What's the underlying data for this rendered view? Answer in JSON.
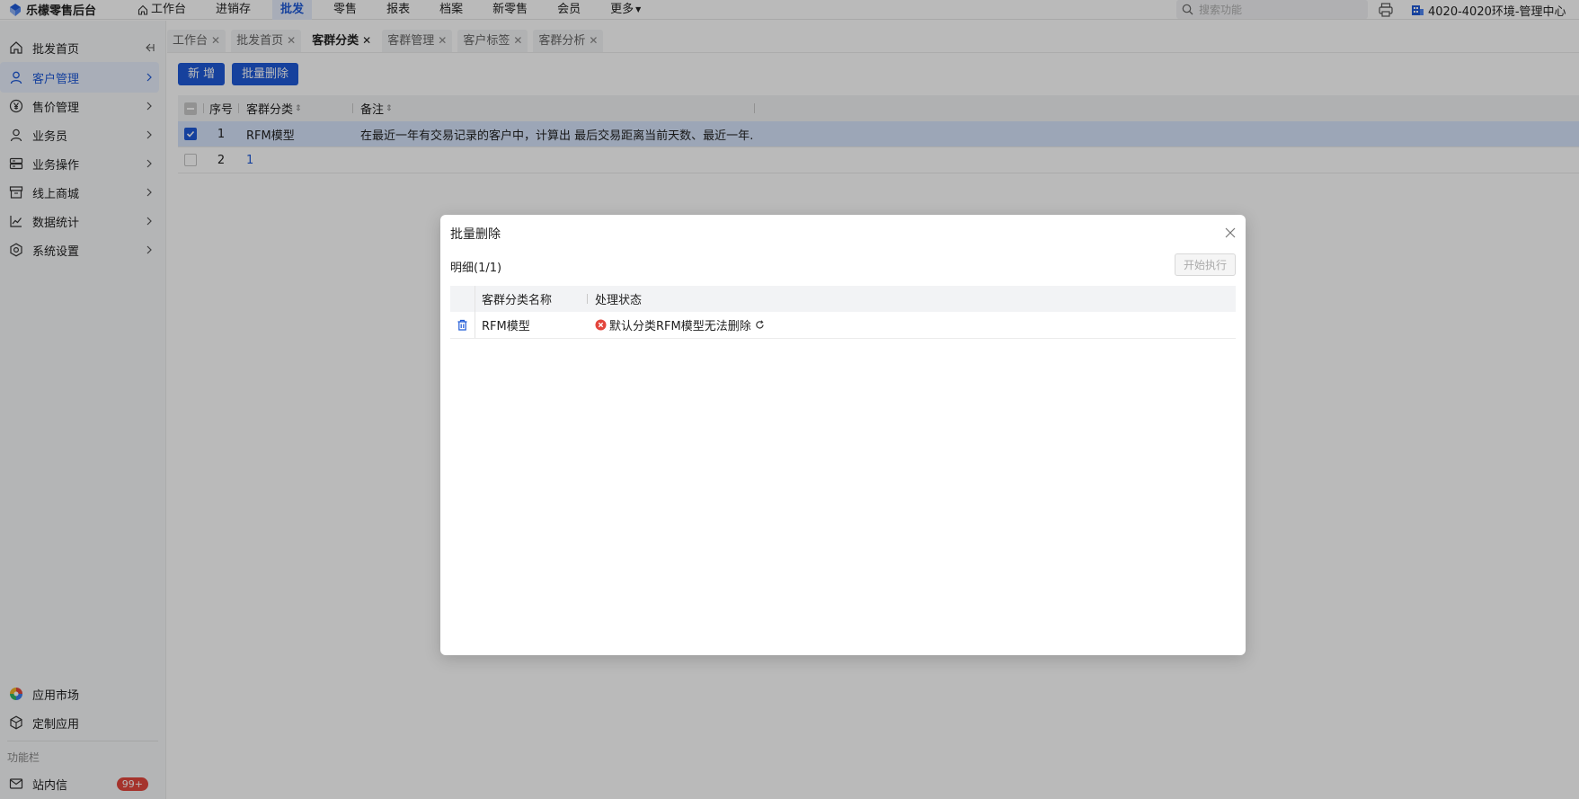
{
  "app": {
    "title": "乐檬零售后台"
  },
  "topnav": [
    {
      "label": "工作台",
      "icon": "home-icon",
      "active": false
    },
    {
      "label": "进销存",
      "active": false
    },
    {
      "label": "批发",
      "active": true
    },
    {
      "label": "零售",
      "active": false
    },
    {
      "label": "报表",
      "active": false
    },
    {
      "label": "档案",
      "active": false
    },
    {
      "label": "新零售",
      "active": false
    },
    {
      "label": "会员",
      "active": false
    },
    {
      "label": "更多",
      "active": false,
      "dropdown": true
    }
  ],
  "search": {
    "placeholder": "搜索功能"
  },
  "org": {
    "label": "4020-4020环境-管理中心"
  },
  "sidebar": {
    "items": [
      {
        "label": "批发首页",
        "icon": "home-icon",
        "collapse_icon": "collapse-left-icon"
      },
      {
        "label": "客户管理",
        "icon": "user-icon",
        "active": true
      },
      {
        "label": "售价管理",
        "icon": "yen-icon"
      },
      {
        "label": "业务员",
        "icon": "person-icon"
      },
      {
        "label": "业务操作",
        "icon": "server-icon"
      },
      {
        "label": "线上商城",
        "icon": "store-icon"
      },
      {
        "label": "数据统计",
        "icon": "chart-line-icon"
      },
      {
        "label": "系统设置",
        "icon": "settings-icon"
      }
    ],
    "bottom_items": [
      {
        "label": "应用市场",
        "icon": "app-market-icon"
      },
      {
        "label": "定制应用",
        "icon": "cube-icon"
      }
    ],
    "section_label": "功能栏",
    "inbox": {
      "label": "站内信",
      "badge": "99+"
    }
  },
  "tabs": [
    {
      "label": "工作台"
    },
    {
      "label": "批发首页"
    },
    {
      "label": "客群分类",
      "active": true
    },
    {
      "label": "客群管理"
    },
    {
      "label": "客户标签"
    },
    {
      "label": "客群分析"
    }
  ],
  "toolbar": {
    "add_label": "新 增",
    "batch_delete_label": "批量删除"
  },
  "table": {
    "columns": {
      "no": "序号",
      "name": "客群分类",
      "note": "备注"
    },
    "rows": [
      {
        "no": "1",
        "name": "RFM模型",
        "note": "在最近一年有交易记录的客户中，计算出 最后交易距离当前天数、最近一年…",
        "checked": true
      },
      {
        "no": "2",
        "name": "1",
        "note": "",
        "checked": false
      }
    ]
  },
  "modal": {
    "title": "批量删除",
    "subtitle": "明细(1/1)",
    "exec_label": "开始执行",
    "columns": {
      "name": "客群分类名称",
      "status": "处理状态"
    },
    "rows": [
      {
        "name": "RFM模型",
        "status": "默认分类RFM模型无法删除"
      }
    ]
  },
  "colors": {
    "primary": "#1f5ad8",
    "error": "#e3463d",
    "badge": "#e3463d"
  }
}
